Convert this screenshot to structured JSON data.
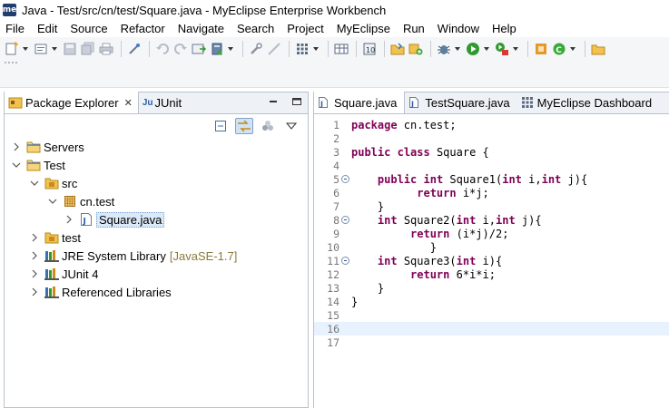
{
  "window": {
    "app_icon_text": "me",
    "title": "Java - Test/src/cn/test/Square.java - MyEclipse Enterprise Workbench"
  },
  "menu": [
    "File",
    "Edit",
    "Source",
    "Refactor",
    "Navigate",
    "Search",
    "Project",
    "MyEclipse",
    "Run",
    "Window",
    "Help"
  ],
  "left_panel": {
    "tabs": [
      {
        "label": "Package Explorer",
        "close": "✕"
      },
      {
        "label": "JUnit",
        "icon_text": "Ju"
      }
    ],
    "tree": [
      {
        "label": "Servers",
        "icon": "folder-icon",
        "expanded": false,
        "depth": 0
      },
      {
        "label": "Test",
        "icon": "project-folder-icon",
        "expanded": true,
        "depth": 0
      },
      {
        "label": "src",
        "icon": "source-folder-icon",
        "expanded": true,
        "depth": 1
      },
      {
        "label": "cn.test",
        "icon": "package-icon",
        "expanded": true,
        "depth": 2
      },
      {
        "label": "Square.java",
        "icon": "java-file-icon",
        "expanded": false,
        "depth": 3,
        "selected": true
      },
      {
        "label": "test",
        "icon": "source-folder-icon",
        "expanded": false,
        "depth": 1
      },
      {
        "label": "JRE System Library",
        "decoration": "[JavaSE-1.7]",
        "icon": "library-icon",
        "expanded": false,
        "depth": 1
      },
      {
        "label": "JUnit 4",
        "icon": "library-icon",
        "expanded": false,
        "depth": 1
      },
      {
        "label": "Referenced Libraries",
        "icon": "library-icon",
        "expanded": false,
        "depth": 1
      }
    ]
  },
  "editor": {
    "tabs": [
      {
        "label": "Square.java",
        "active": true
      },
      {
        "label": "TestSquare.java",
        "active": false
      },
      {
        "label": "MyEclipse Dashboard",
        "active": false
      }
    ],
    "current_line": 16,
    "lines": [
      {
        "n": "1",
        "text": "package cn.test;"
      },
      {
        "n": "2",
        "text": ""
      },
      {
        "n": "3",
        "text": "public class Square {"
      },
      {
        "n": "4",
        "text": ""
      },
      {
        "n": "5",
        "text": "    public int Square1(int i,int j){",
        "fold": true
      },
      {
        "n": "6",
        "text": "          return i*j;"
      },
      {
        "n": "7",
        "text": "    }"
      },
      {
        "n": "8",
        "text": "    int Square2(int i,int j){",
        "fold": true
      },
      {
        "n": "9",
        "text": "         return (i*j)/2;"
      },
      {
        "n": "10",
        "text": "            }"
      },
      {
        "n": "11",
        "text": "    int Square3(int i){",
        "fold": true
      },
      {
        "n": "12",
        "text": "         return 6*i*i;"
      },
      {
        "n": "13",
        "text": "    }"
      },
      {
        "n": "14",
        "text": "}"
      },
      {
        "n": "15",
        "text": ""
      },
      {
        "n": "16",
        "text": ""
      },
      {
        "n": "17",
        "text": ""
      }
    ]
  },
  "colors": {
    "keyword": "#7f0055",
    "selection": "#dbe9f8",
    "current_line": "#e8f2fe",
    "tree_decoration": "#8a7b3a"
  }
}
